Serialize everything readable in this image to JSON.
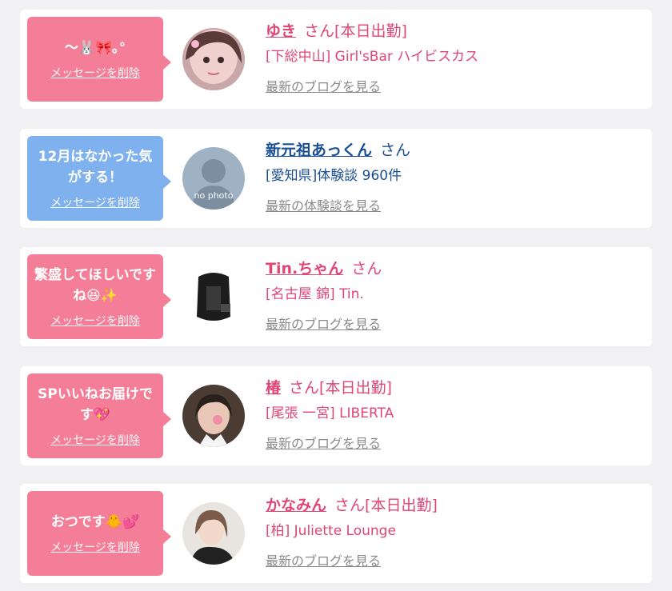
{
  "colors": {
    "pink": "#f47e97",
    "blue": "#7fb1ee",
    "name_pink": "#e04574",
    "name_blue": "#1a4f93",
    "link_gray": "#8a8a8a"
  },
  "items": [
    {
      "message": "～🐰🎀｡°",
      "delete_label": "メッセージを削除",
      "name": "ゆき",
      "honorific": "さん",
      "status": "[本日出勤]",
      "shop": "[下総中山] Girl'sBar ハイビスカス",
      "link": "最新のブログを見る",
      "avatar_icon": "photo-avatar-icon"
    },
    {
      "message": "12月はなかった気がする！",
      "delete_label": "メッセージを削除",
      "name": "新元祖あっくん",
      "honorific": "さん",
      "status": "",
      "shop": "[愛知県]体験談 960件",
      "link": "最新の体験談を見る",
      "avatar_text": "no photo",
      "avatar_icon": "no-photo-avatar-icon"
    },
    {
      "message": "繁盛してほしいですね😆✨",
      "delete_label": "メッセージを削除",
      "name": "Tin.ちゃん",
      "honorific": "さん",
      "status": "",
      "shop": "[名古屋 錦] Tin.",
      "link": "最新のブログを見る",
      "avatar_icon": "photo-avatar-icon"
    },
    {
      "message": "SPいいねお届けです💖",
      "delete_label": "メッセージを削除",
      "name": "椿",
      "honorific": "さん",
      "status": "[本日出勤]",
      "shop": "[尾張 一宮] LIBERTA",
      "link": "最新のブログを見る",
      "avatar_icon": "photo-avatar-icon"
    },
    {
      "message": "おつです🐥💕",
      "delete_label": "メッセージを削除",
      "name": "かなみん",
      "honorific": "さん",
      "status": "[本日出勤]",
      "shop": "[柏] Juliette Lounge",
      "link": "最新のブログを見る",
      "avatar_icon": "photo-avatar-icon"
    }
  ]
}
